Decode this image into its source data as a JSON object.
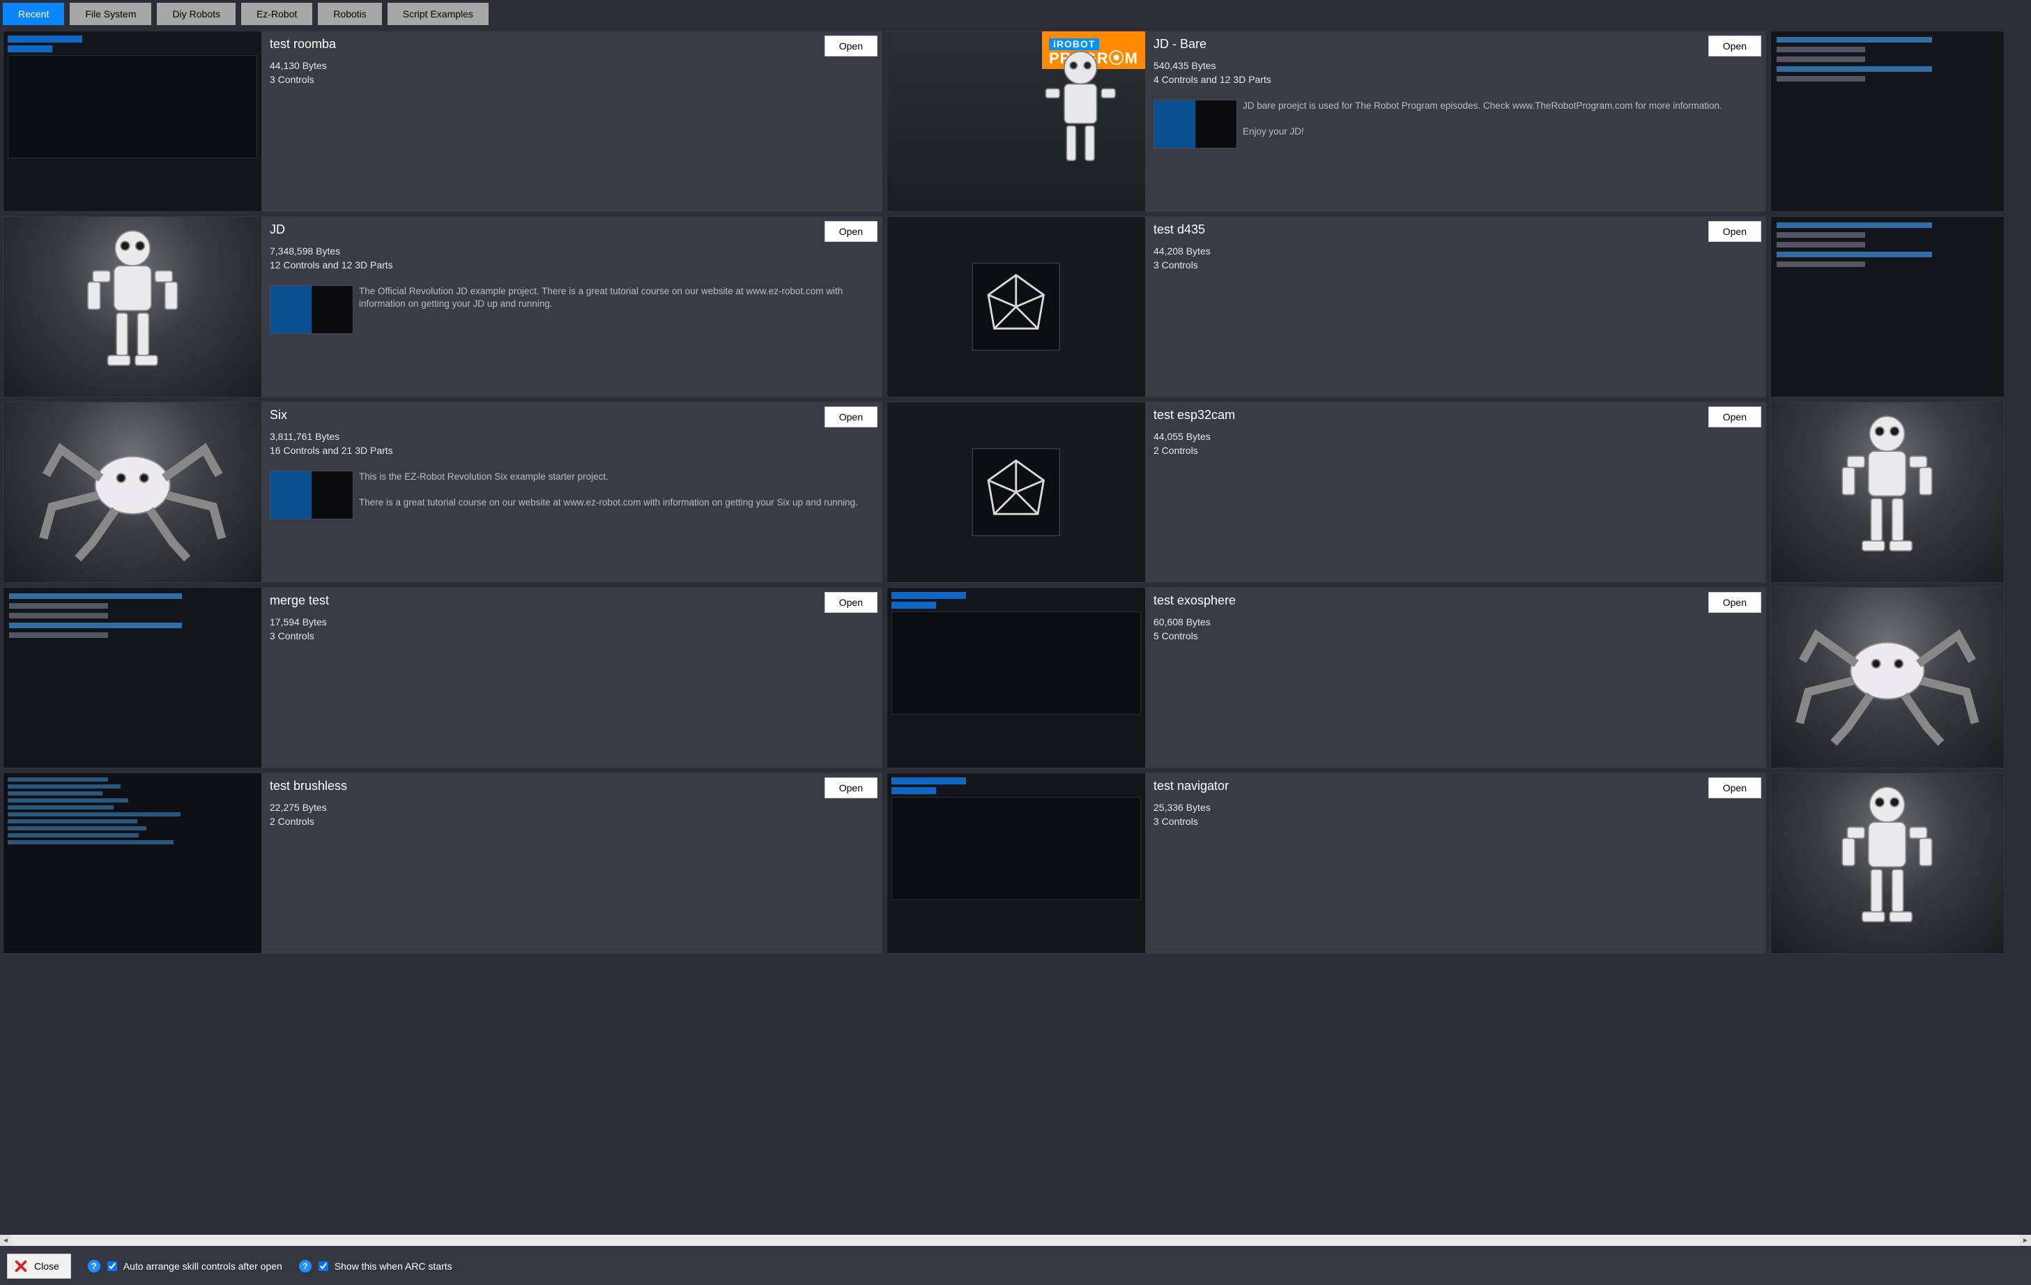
{
  "tabs": [
    {
      "label": "Recent",
      "active": true
    },
    {
      "label": "File System",
      "active": false
    },
    {
      "label": "Diy Robots",
      "active": false
    },
    {
      "label": "Ez-Robot",
      "active": false
    },
    {
      "label": "Robotis",
      "active": false
    },
    {
      "label": "Script Examples",
      "active": false
    }
  ],
  "open_label": "Open",
  "rows": [
    {
      "left": {
        "title": "test roomba",
        "size": "44,130 Bytes",
        "controls": "3 Controls",
        "thumb": "dark-ui",
        "desc": "",
        "desc_thumb": false
      },
      "right": {
        "title": "JD - Bare",
        "size": "540,435 Bytes",
        "controls": "4 Controls and 12 3D Parts",
        "thumb": "robot-program",
        "desc": "JD bare proejct is used for The Robot Program episodes. Check www.TheRobotProgram.com for more information.\n\nEnjoy your JD!",
        "desc_thumb": true
      },
      "side": {
        "thumb": "listing"
      }
    },
    {
      "left": {
        "title": "JD",
        "size": "7,348,598 Bytes",
        "controls": "12 Controls and 12 3D Parts",
        "thumb": "jd",
        "desc": "The Official Revolution JD example project. There is a great tutorial course on our website at www.ez-robot.com with information on getting your JD up and running.",
        "desc_thumb": true
      },
      "right": {
        "title": "test d435",
        "size": "44,208 Bytes",
        "controls": "3 Controls",
        "thumb": "camera",
        "desc": "",
        "desc_thumb": false
      },
      "side": {
        "thumb": "listing"
      }
    },
    {
      "left": {
        "title": "Six",
        "size": "3,811,761 Bytes",
        "controls": "16 Controls and 21 3D Parts",
        "thumb": "six",
        "desc": "This is the EZ-Robot Revolution Six example starter project.\n\nThere is a great tutorial course on our website at www.ez-robot.com with information on getting your Six up and running.",
        "desc_thumb": true
      },
      "right": {
        "title": "test esp32cam",
        "size": "44,055 Bytes",
        "controls": "2 Controls",
        "thumb": "camera",
        "desc": "",
        "desc_thumb": false
      },
      "side": {
        "thumb": "jd-side"
      }
    },
    {
      "left": {
        "title": "merge test",
        "size": "17,594 Bytes",
        "controls": "3 Controls",
        "thumb": "listing",
        "desc": "",
        "desc_thumb": false
      },
      "right": {
        "title": "test exosphere",
        "size": "60,608 Bytes",
        "controls": "5 Controls",
        "thumb": "dark-ui",
        "desc": "",
        "desc_thumb": false
      },
      "side": {
        "thumb": "six-side"
      }
    },
    {
      "left": {
        "title": "test brushless",
        "size": "22,275 Bytes",
        "controls": "2 Controls",
        "thumb": "code",
        "desc": "",
        "desc_thumb": false
      },
      "right": {
        "title": "test navigator",
        "size": "25,336 Bytes",
        "controls": "3 Controls",
        "thumb": "dark-ui",
        "desc": "",
        "desc_thumb": false
      },
      "side": {
        "thumb": "jd-side"
      }
    }
  ],
  "footer": {
    "close": "Close",
    "opt1": "Auto arrange skill controls after open",
    "opt2": "Show this when ARC starts"
  }
}
